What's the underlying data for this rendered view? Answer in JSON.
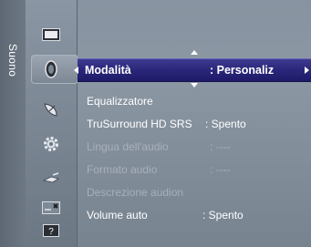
{
  "side_tab": {
    "label": "Suono"
  },
  "icons": [
    "picture-icon",
    "speaker-icon",
    "satellite-dish-icon",
    "settings-gear-icon",
    "input-plug-icon",
    "applications-icon",
    "support-question-icon"
  ],
  "menu": {
    "selected": {
      "name": "Modalità",
      "value": ": Personaliz"
    },
    "items": [
      {
        "name": "Equalizzatore",
        "value": "",
        "enabled": true
      },
      {
        "name": "TruSurround HD SRS",
        "value": ": Spento",
        "enabled": true
      },
      {
        "name": "Lingua dell'audio",
        "value": ": ----",
        "enabled": false
      },
      {
        "name": "Formato audio",
        "value": ": ----",
        "enabled": false
      },
      {
        "name": "Descrezione audion",
        "value": "",
        "enabled": false
      },
      {
        "name": "Volume auto",
        "value": ": Spento",
        "enabled": true
      }
    ]
  },
  "colors": {
    "highlight": "#2a267a",
    "text": "#ffffff",
    "disabled_text": "#a7b0ba"
  }
}
